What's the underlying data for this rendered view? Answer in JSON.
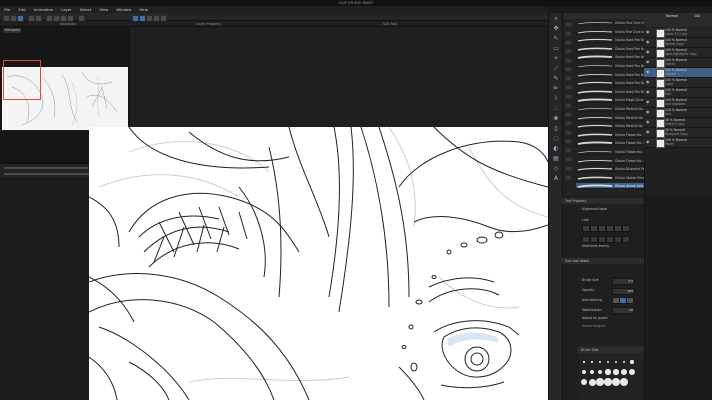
{
  "window": {
    "title": "CLIP STUDIO PAINT"
  },
  "menu": [
    "File",
    "Edit",
    "View",
    "Layer",
    "Select",
    "View",
    "Window",
    "Help"
  ],
  "menu_labels": {
    "file": "File",
    "edit": "Edit",
    "animation": "Animation",
    "layer": "Layer",
    "select": "Select",
    "view": "View",
    "window": "Window",
    "help": "Help"
  },
  "panels": {
    "navigator": "Navigator",
    "layer_property": "Layer Property",
    "sub_tool": "Sub Tool",
    "tool_property": "Tool Property",
    "brush_size": "Brush Size"
  },
  "navigator": {
    "tab": "Navigator",
    "zoom": "100.0"
  },
  "sub_tool": {
    "brushes": [
      {
        "name": "Okuha Fine Cure Inc."
      },
      {
        "name": "Okuha Fine Cure Inc."
      },
      {
        "name": "Okuha Hard Pen No. 1"
      },
      {
        "name": "Okuha Hard Pen No. 2"
      },
      {
        "name": "Okuha Hard Pen No. 3"
      },
      {
        "name": "Okuha Hard Pen No. 4"
      },
      {
        "name": "Okuha Hard Pen No. 5"
      },
      {
        "name": "Okuha Hard Pen No. 6"
      },
      {
        "name": "Okuha Hard Pen No. 7"
      },
      {
        "name": "Okuha Magic Dust No."
      },
      {
        "name": "Okuha Particle No. 1"
      },
      {
        "name": "Okuha Particle No. 2"
      },
      {
        "name": "Okuha Particle No. 3"
      },
      {
        "name": "Okuha Flower No. 1"
      },
      {
        "name": "Okuha Flower No. 2"
      },
      {
        "name": "Okuha Flower No. 3"
      },
      {
        "name": "Okuha Flower No. 4"
      },
      {
        "name": "Okuha Blueprint Pencil"
      },
      {
        "name": "Okuha Sketch Pencil"
      },
      {
        "name": "Okuha Anime Line Art"
      }
    ]
  },
  "layers": {
    "blend_mode": "Normal",
    "opacity": "100",
    "items": [
      {
        "name": "100 % Normal",
        "sub": "Layer 12 Copy"
      },
      {
        "name": "100 % Normal",
        "sub": "Okuha Copy"
      },
      {
        "name": "100 % Normal",
        "sub": "light highlights Copy"
      },
      {
        "name": "100 % Normal",
        "sub": "Sketch"
      },
      {
        "name": "100 % Normal",
        "sub": "Lineart"
      },
      {
        "name": "100 % Normal",
        "sub": "Layer"
      },
      {
        "name": "100 % Normal",
        "sub": "Hair"
      },
      {
        "name": "100 % Normal",
        "sub": "hair shadows"
      },
      {
        "name": "100 % Normal",
        "sub": "hair"
      },
      {
        "name": "30 % Normal",
        "sub": "Sketch Copy"
      },
      {
        "name": "30 % Normal",
        "sub": "Blueprint Copy"
      },
      {
        "name": "100 % Normal",
        "sub": "Paper"
      }
    ]
  },
  "tool_property": {
    "header": "Tool Property",
    "alignment_label": "Alignment base",
    "line_label": "Line",
    "distribute_label": "Distribute evenly",
    "brush_size_label": "Brush Size",
    "brush_size_value": "5.0",
    "opacity_label": "Opacity",
    "opacity_value": "100",
    "anti_alias_label": "Anti-aliasing",
    "stabilization_label": "Stabilization",
    "stabilization_value": "20",
    "adjust_speed_label": "Adjust by speed",
    "vector_label": "Vector magnet",
    "layer_property_hdr": "Sub tool detail",
    "drag_label": "Pen pressure"
  },
  "brush_size": {
    "header": "Brush Size"
  },
  "colors": {
    "accent": "#3d6fa8",
    "panel": "#222222",
    "canvas": "#ffffff",
    "selection": "#405f85"
  }
}
